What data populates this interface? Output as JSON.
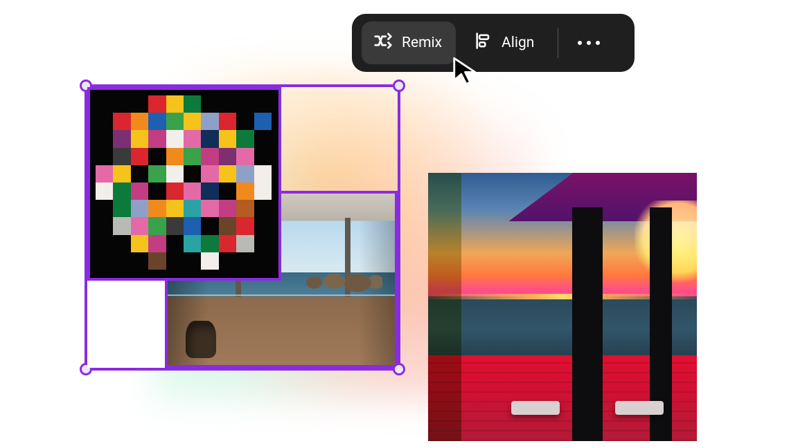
{
  "toolbar": {
    "remix_label": "Remix",
    "align_label": "Align",
    "icons": {
      "remix": "remix-icon",
      "align": "align-icon",
      "more": "more-icon"
    }
  },
  "mosaic": {
    "palette": {
      "k": "#050505",
      "w": "#f2eee9",
      "r": "#d9262f",
      "o": "#f08a1d",
      "y": "#f6c21c",
      "g": "#0c7a3b",
      "G": "#3aa24b",
      "b": "#1e5fb0",
      "B": "#112d5a",
      "p": "#e36aa6",
      "P": "#7d2f73",
      "m": "#c23d82",
      "t": "#2aa3a3",
      "c": "#b9bab6",
      "d": "#3a3a3a",
      "s": "#8fa0c8",
      "h": "#6a4428",
      "a": "#b55b24"
    },
    "rows": [
      "kkkrygkkkk",
      "krobGysrkb",
      "kPymwpBygk",
      "kdrkoGmPpk",
      "pykGwkpysw",
      "wgmkrpBkow",
      "kgsoytpmak",
      "kcpGdbkhrk",
      "kkymktgrck",
      "kkkhkkwkkk"
    ]
  }
}
